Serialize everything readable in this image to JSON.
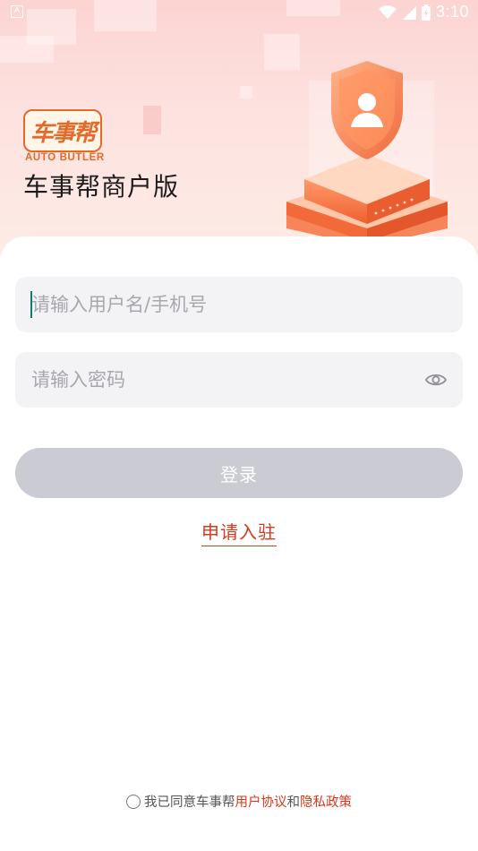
{
  "status_bar": {
    "time": "3:10",
    "left_icon": "A"
  },
  "brand": {
    "logo_text": "车事帮",
    "logo_sub": "AUTO BUTLER",
    "app_title": "车事帮商户版"
  },
  "form": {
    "username_placeholder": "请输入用户名/手机号",
    "username_value": "",
    "password_placeholder": "请输入密码",
    "password_value": "",
    "login_label": "登录",
    "apply_label": "申请入驻"
  },
  "agreement": {
    "prefix": "我已同意车事帮",
    "user_agreement": "用户协议",
    "and": "和",
    "privacy_policy": "隐私政策"
  },
  "colors": {
    "accent": "#d5391e",
    "brand_orange": "#e26a2a",
    "button_disabled": "#cbcbd3",
    "input_bg": "#f3f3f6"
  },
  "icons": {
    "status_left": "app-notification-icon",
    "wifi": "wifi-icon",
    "signal": "cellular-signal-icon",
    "battery": "battery-icon",
    "password_toggle": "eye-icon",
    "agree_toggle": "radio-icon",
    "illustration": "shield-user-icon"
  }
}
